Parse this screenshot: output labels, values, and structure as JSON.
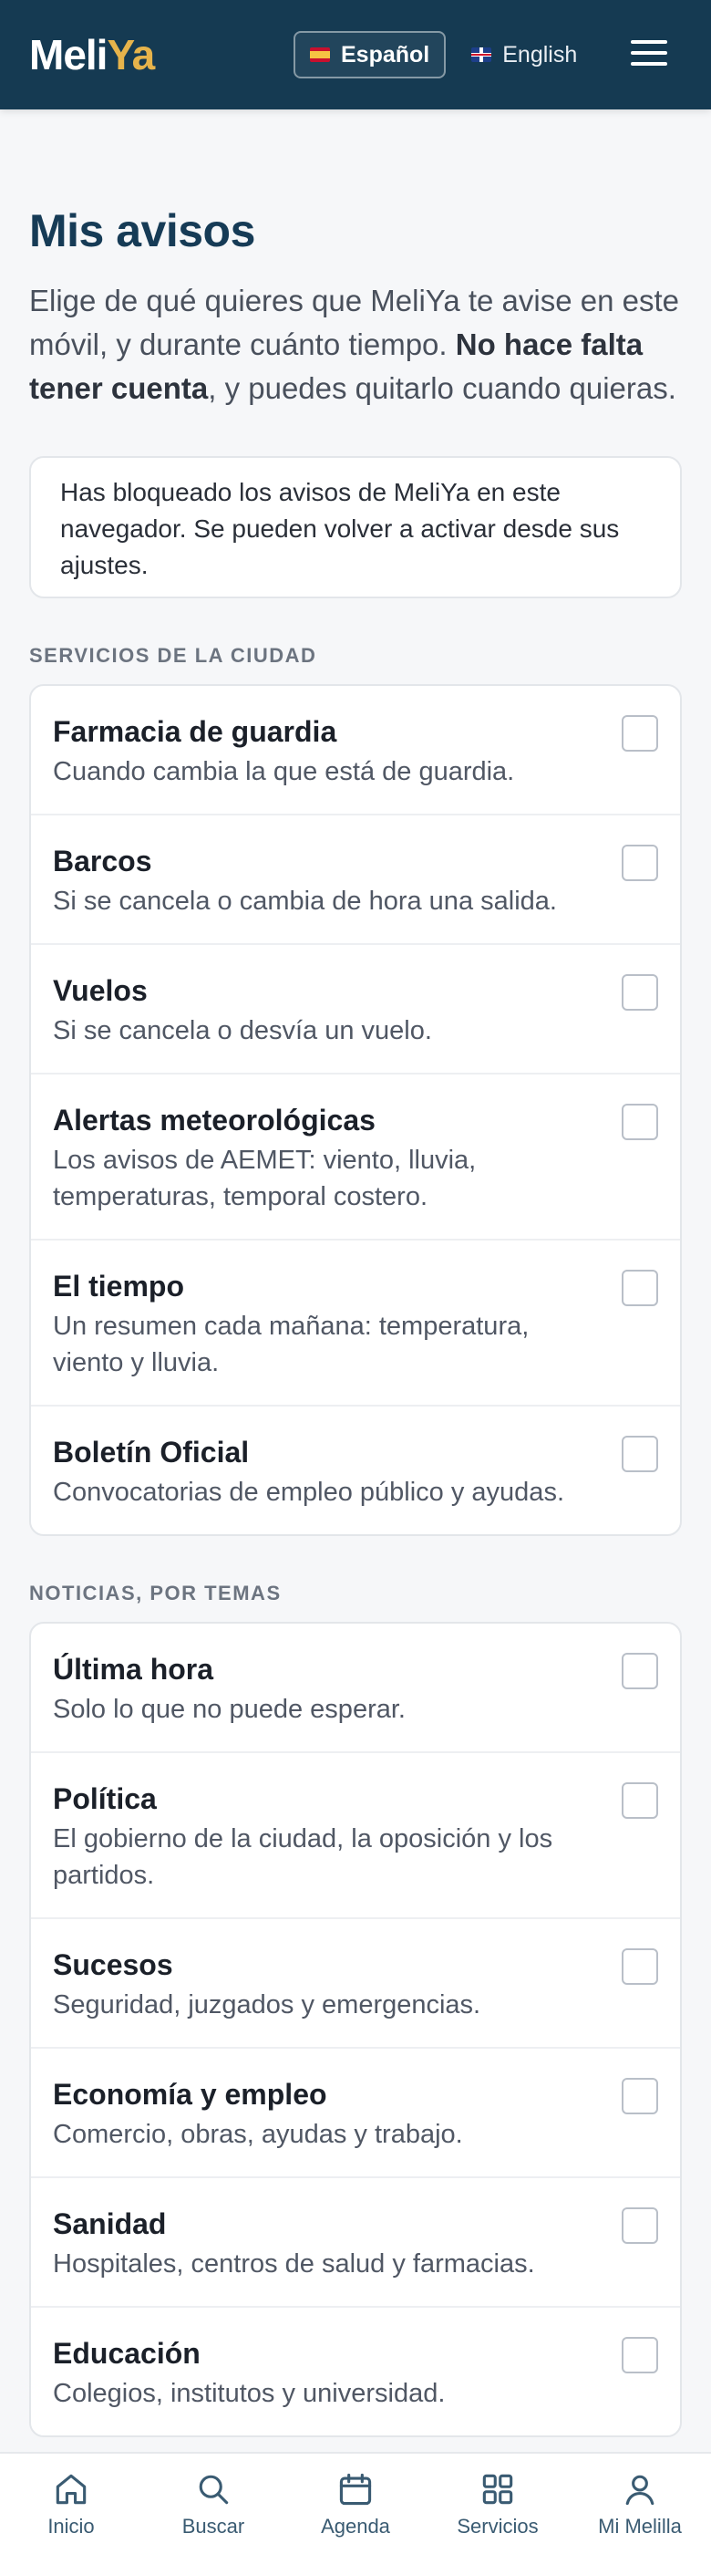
{
  "header": {
    "logo_main": "Meli",
    "logo_accent": "Ya",
    "languages": [
      {
        "label": "Español",
        "active": true
      },
      {
        "label": "English",
        "active": false
      }
    ],
    "menu_icon": "hamburger-menu-icon"
  },
  "page": {
    "title": "Mis avisos",
    "intro_before": "Elige de qué quieres que MeliYa te avise en este móvil, y durante cuánto tiempo. ",
    "intro_bold": "No hace falta tener cuenta",
    "intro_after": ", y puedes quitarlo cuando quieras.",
    "notice": "Has bloqueado los avisos de MeliYa en este navegador. Se pueden volver a activar desde sus ajustes."
  },
  "sections": [
    {
      "title": "Servicios de la ciudad",
      "items": [
        {
          "title": "Farmacia de guardia",
          "desc": "Cuando cambia la que está de guardia.",
          "checked": false
        },
        {
          "title": "Barcos",
          "desc": "Si se cancela o cambia de hora una salida.",
          "checked": false
        },
        {
          "title": "Vuelos",
          "desc": "Si se cancela o desvía un vuelo.",
          "checked": false
        },
        {
          "title": "Alertas meteorológicas",
          "desc": "Los avisos de AEMET: viento, lluvia, temperaturas, temporal costero.",
          "checked": false
        },
        {
          "title": "El tiempo",
          "desc": "Un resumen cada mañana: temperatura, viento y lluvia.",
          "checked": false
        },
        {
          "title": "Boletín Oficial",
          "desc": "Convocatorias de empleo público y ayudas.",
          "checked": false
        }
      ]
    },
    {
      "title": "Noticias, por temas",
      "items": [
        {
          "title": "Última hora",
          "desc": "Solo lo que no puede esperar.",
          "checked": false
        },
        {
          "title": "Política",
          "desc": "El gobierno de la ciudad, la oposición y los partidos.",
          "checked": false
        },
        {
          "title": "Sucesos",
          "desc": "Seguridad, juzgados y emergencias.",
          "checked": false
        },
        {
          "title": "Economía y empleo",
          "desc": "Comercio, obras, ayudas y trabajo.",
          "checked": false
        },
        {
          "title": "Sanidad",
          "desc": "Hospitales, centros de salud y farmacias.",
          "checked": false
        },
        {
          "title": "Educación",
          "desc": "Colegios, institutos y universidad.",
          "checked": false
        }
      ]
    }
  ],
  "bottom_nav": [
    {
      "label": "Inicio",
      "icon": "home-icon"
    },
    {
      "label": "Buscar",
      "icon": "search-icon"
    },
    {
      "label": "Agenda",
      "icon": "calendar-icon"
    },
    {
      "label": "Servicios",
      "icon": "grid-icon"
    },
    {
      "label": "Mi Melilla",
      "icon": "user-icon"
    }
  ]
}
